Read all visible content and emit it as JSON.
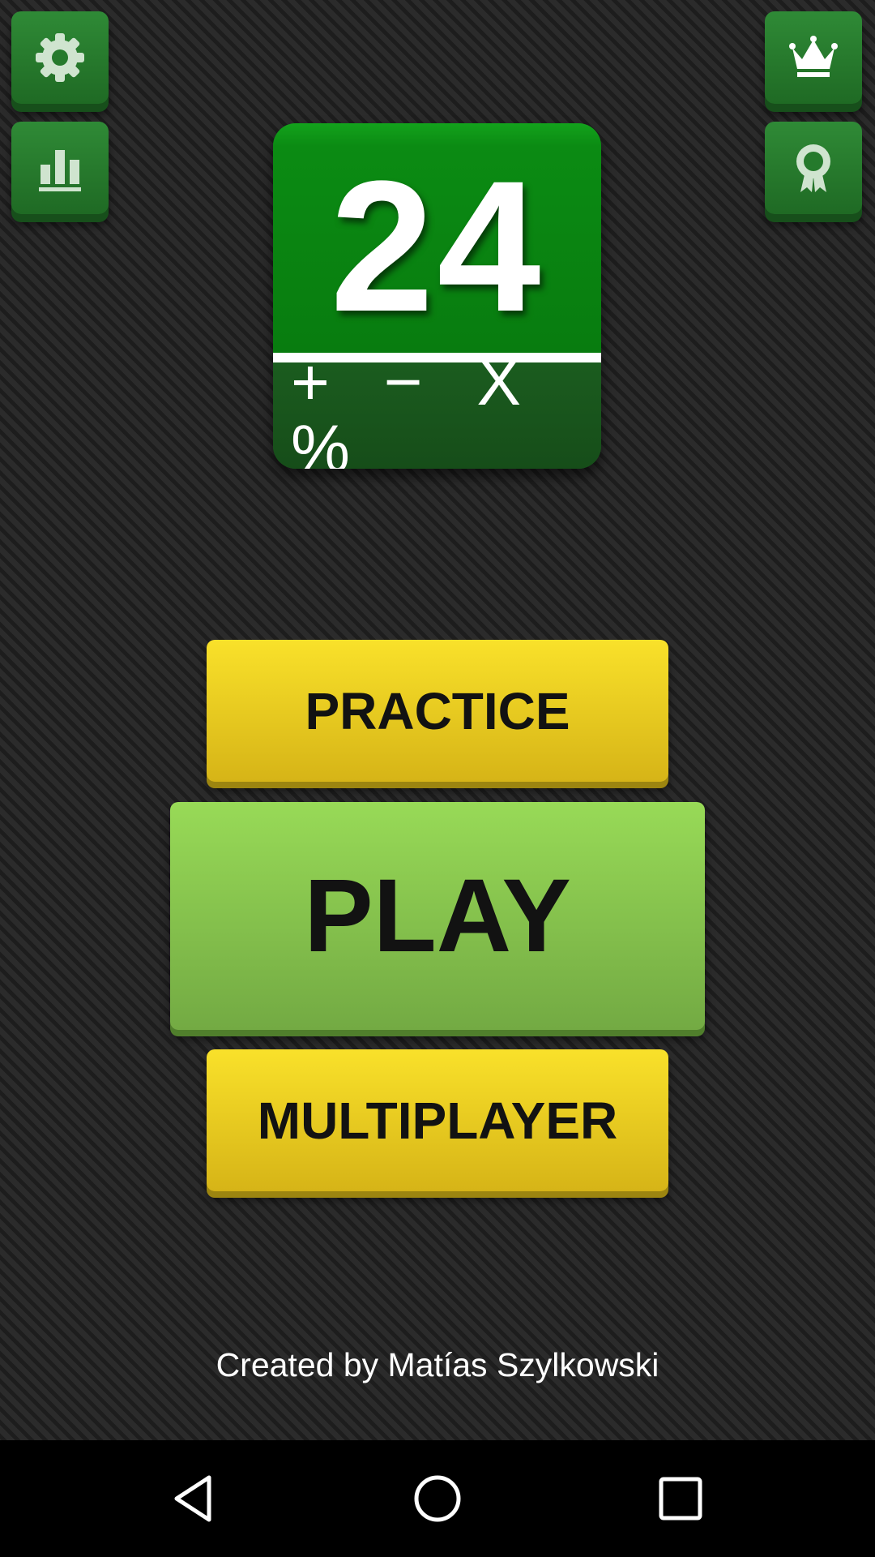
{
  "top_left": {
    "settings": {
      "icon": "gear-icon"
    },
    "stats": {
      "icon": "bar-chart-icon"
    }
  },
  "top_right": {
    "leaderboard": {
      "icon": "crown-icon"
    },
    "achievements": {
      "icon": "award-ribbon-icon"
    }
  },
  "logo": {
    "number": "24",
    "operators": "+ − X %"
  },
  "menu": {
    "practice_label": "PRACTICE",
    "play_label": "PLAY",
    "multiplayer_label": "MULTIPLAYER"
  },
  "footer": {
    "credit": "Created by Matías Szylkowski"
  },
  "nav_bar": {
    "back": {
      "icon": "back-triangle-icon"
    },
    "home": {
      "icon": "home-circle-icon"
    },
    "recents": {
      "icon": "recents-square-icon"
    }
  },
  "colors": {
    "corner_button": "#2a7d31",
    "yellow_button": "#f3d420",
    "play_button": "#8ccc50",
    "logo_green": "#0b8b13",
    "logo_dark": "#1b5c1f"
  }
}
